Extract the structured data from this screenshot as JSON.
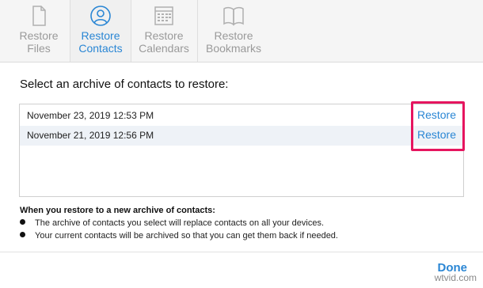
{
  "tabs": [
    {
      "line1": "Restore",
      "line2": "Files",
      "icon": "file-icon"
    },
    {
      "line1": "Restore",
      "line2": "Contacts",
      "icon": "contacts-icon"
    },
    {
      "line1": "Restore",
      "line2": "Calendars",
      "icon": "calendar-icon"
    },
    {
      "line1": "Restore",
      "line2": "Bookmarks",
      "icon": "bookmarks-icon"
    }
  ],
  "colors": {
    "accent": "#2a86d4",
    "highlight": "#e6155f"
  },
  "prompt": "Select an archive of contacts to restore:",
  "archives": [
    {
      "date": "November 23, 2019 12:53 PM",
      "action": "Restore"
    },
    {
      "date": "November 21, 2019 12:56 PM",
      "action": "Restore"
    }
  ],
  "info": {
    "heading": "When you restore to a new archive of contacts:",
    "bullets": [
      "The archive of contacts you select will replace contacts on all your devices.",
      "Your current contacts will be archived so that you can get them back if needed."
    ]
  },
  "done_label": "Done",
  "watermark": "wtvid.com"
}
